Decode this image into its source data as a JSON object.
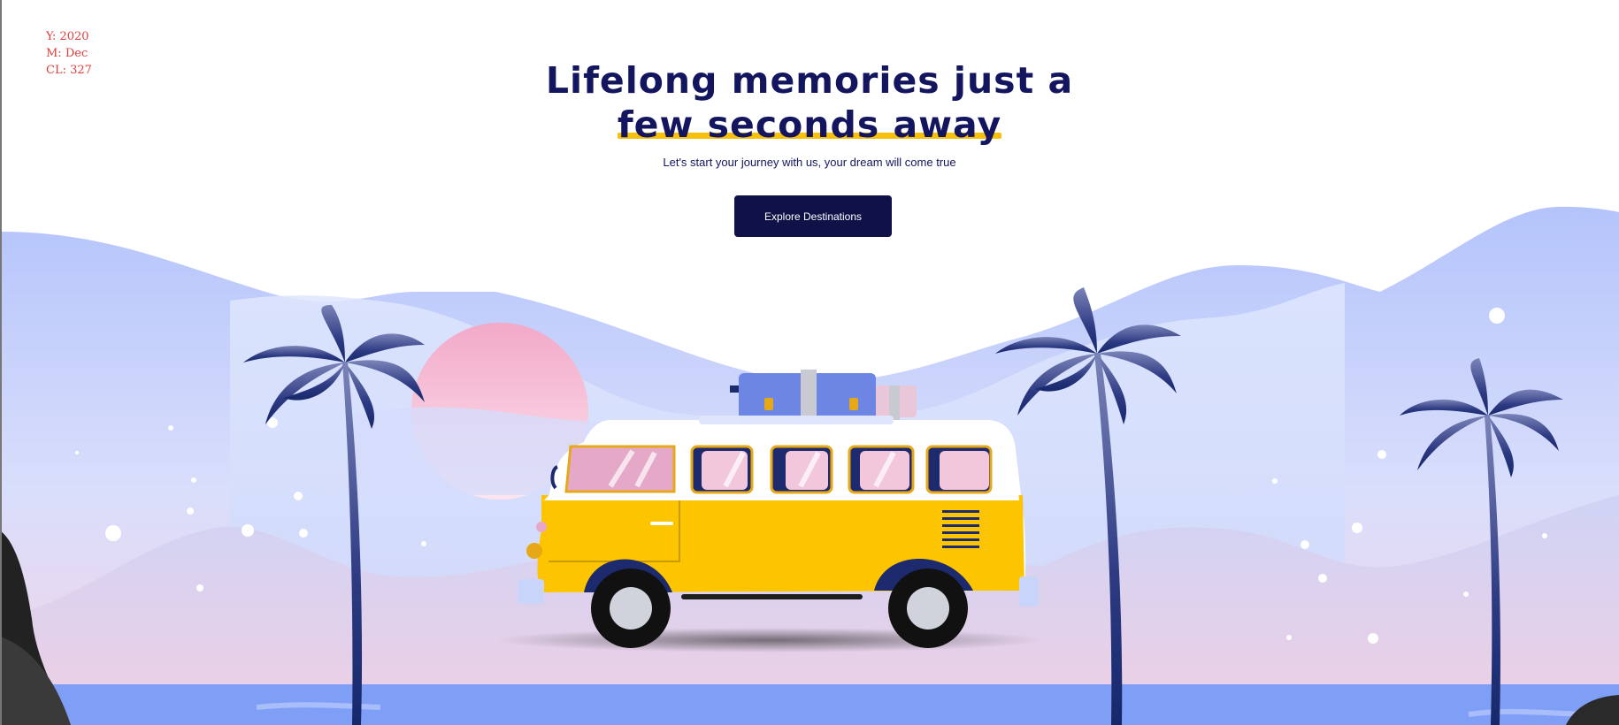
{
  "debug": {
    "year": "Y: 2020",
    "month": "M: Dec",
    "cl": "CL: 327"
  },
  "hero": {
    "title_line1": "Lifelong memories just a",
    "title_line2": "few seconds away",
    "subtitle": "Let's start your journey with us, your dream will come true",
    "cta_label": "Explore Destinations"
  },
  "colors": {
    "navy": "#13155e",
    "accent_yellow": "#f6c10d",
    "debug_red": "#e03c3c",
    "button_bg": "#0f1147",
    "sea": "#7f9ff7",
    "sky_hills": "#b6c6fb",
    "van_yellow": "#fdc500"
  },
  "icons": [
    "palm-tree-icon",
    "van-illustration",
    "sun-icon",
    "luggage-icon"
  ]
}
